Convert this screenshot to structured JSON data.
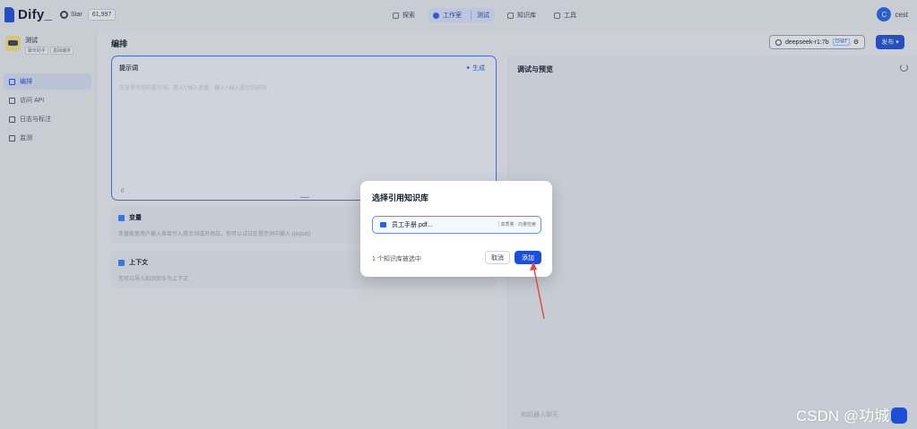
{
  "header": {
    "logo_text": "Dify_",
    "github_label": "Star",
    "github_stars": "61,997",
    "nav": [
      {
        "label": "探索",
        "active": false
      },
      {
        "label": "工作室",
        "active": true,
        "sub": "测试"
      },
      {
        "label": "知识库",
        "active": false
      },
      {
        "label": "工具",
        "active": false
      }
    ],
    "user_initial": "C",
    "user_name": "cest"
  },
  "sidebar": {
    "app_name": "测试",
    "app_tags": [
      "聊天助手",
      "基础编排"
    ],
    "items": [
      {
        "label": "编排",
        "active": true
      },
      {
        "label": "访问 API",
        "active": false
      },
      {
        "label": "日志与标注",
        "active": false
      },
      {
        "label": "监测",
        "active": false
      }
    ]
  },
  "main": {
    "title": "编排",
    "model_name": "deepseek-r1:7b",
    "model_badge": "CHAT",
    "publish_label": "发布",
    "prompt": {
      "label": "提示词",
      "generate_label": "生成",
      "placeholder": "在这里写你的提示词，输入'{'插入变量、输入'/'插入提示内容块",
      "char_count": "0"
    },
    "variables": {
      "title": "变量",
      "desc": "变量能使用户输入表单引入提示词或开场白，你可以试试在提示词中输入 {{input}}"
    },
    "context": {
      "title": "上下文",
      "desc": "您可以导入知识库作为上下文"
    }
  },
  "debug": {
    "title": "调试与预览",
    "chat_placeholder": "和机器人聊天"
  },
  "modal": {
    "title": "选择引用知识库",
    "knowledge_base": {
      "name": "员工手册.pdf...",
      "meta": "高质量 · 向量检索"
    },
    "selected_text": "1 个知识库被选中",
    "cancel_label": "取消",
    "add_label": "添加"
  },
  "watermark": "CSDN @功城师",
  "colors": {
    "accent": "#1d4ed8",
    "arrow": "#e0473a"
  }
}
